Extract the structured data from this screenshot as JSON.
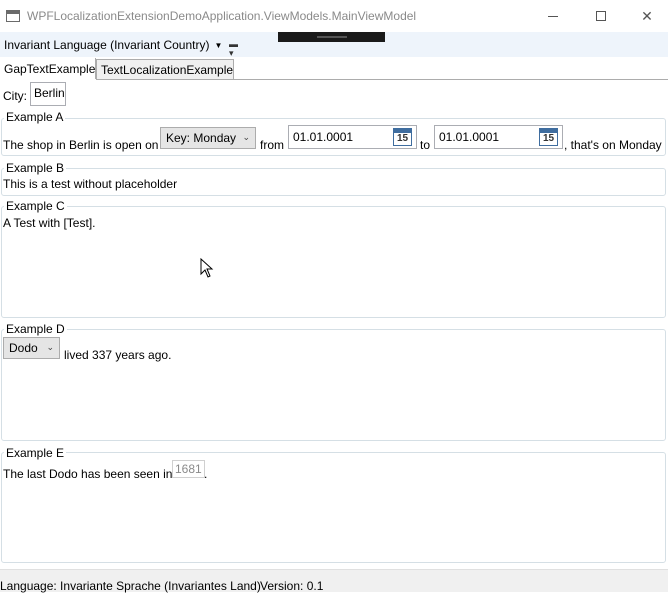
{
  "window": {
    "title": "WPFLocalizationExtensionDemoApplication.ViewModels.MainViewModel",
    "icon": "app-window-icon"
  },
  "toolbar": {
    "language_selected": "Invariant Language (Invariant Country)",
    "overflow_icon": "toolbar-overflow-icon"
  },
  "tabs": [
    {
      "label": "GapTextExample",
      "selected": true
    },
    {
      "label": "TextLocalizationExample",
      "selected": false
    }
  ],
  "city": {
    "label": "City:",
    "value": "Berlin"
  },
  "example_a": {
    "header": "Example A",
    "text1": "The shop in Berlin is open on",
    "day_combo": "Key: Monday",
    "text_from": "from",
    "date_from": "01.01.0001",
    "text_to": "to",
    "date_to": "01.01.0001",
    "text_end": ", that's on Monday",
    "calendar_day": "15"
  },
  "example_b": {
    "header": "Example B",
    "text": "This is a test without placeholder"
  },
  "example_c": {
    "header": "Example C",
    "text": "A Test with [Test]."
  },
  "example_d": {
    "header": "Example D",
    "animal_combo": "Dodo",
    "text": "lived 337 years ago."
  },
  "example_e": {
    "header": "Example E",
    "text1": "The last Dodo has been seen in",
    "year": "1681",
    "text2": "."
  },
  "status": {
    "language": "Language: Invariante Sprache (Invariantes Land)",
    "version": "Version: 0.1"
  }
}
